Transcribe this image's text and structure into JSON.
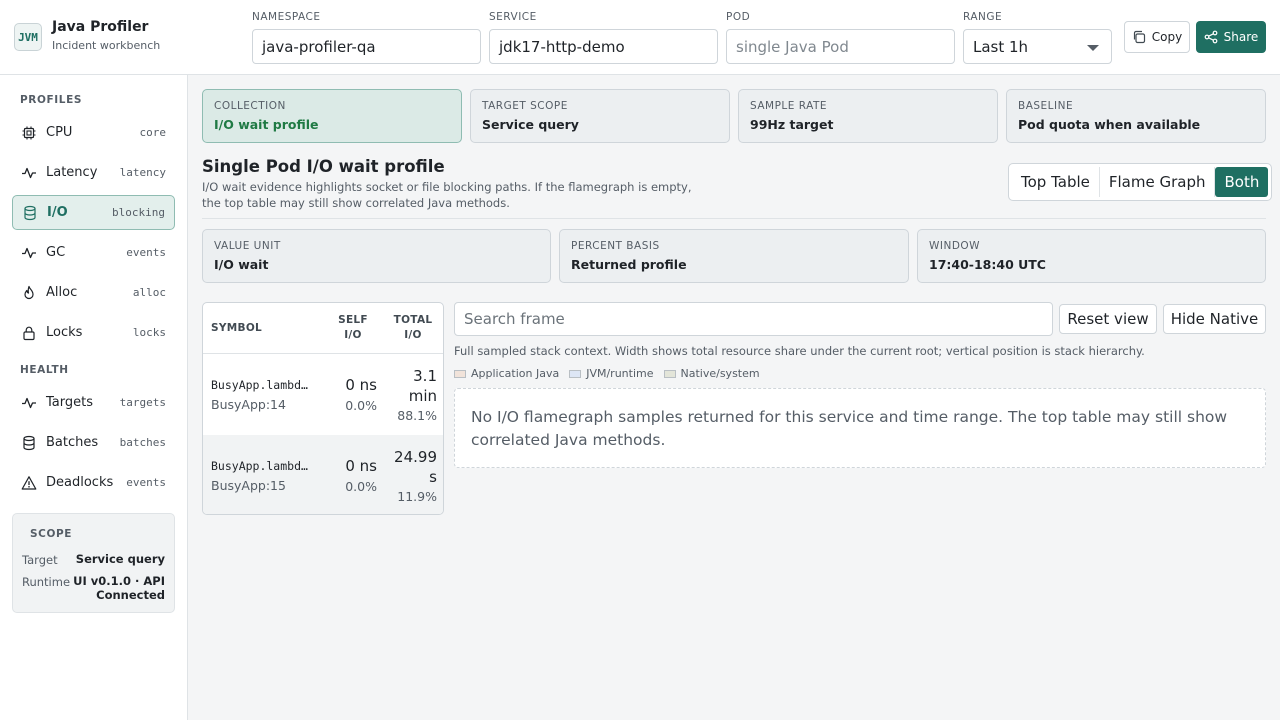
{
  "brand": {
    "logo": "JVM",
    "title": "Java Profiler",
    "subtitle": "Incident workbench"
  },
  "header": {
    "namespace": {
      "label": "NAMESPACE",
      "value": "java-profiler-qa"
    },
    "service": {
      "label": "SERVICE",
      "value": "jdk17-http-demo"
    },
    "pod": {
      "label": "POD",
      "placeholder": "single Java Pod"
    },
    "range": {
      "label": "RANGE",
      "value": "Last 1h"
    },
    "copy_label": "Copy",
    "share_label": "Share"
  },
  "sidebar": {
    "profiles_title": "PROFILES",
    "profiles": [
      {
        "label": "CPU",
        "tag": "core",
        "icon": "cpu-icon"
      },
      {
        "label": "Latency",
        "tag": "latency",
        "icon": "pulse-icon"
      },
      {
        "label": "I/O",
        "tag": "blocking",
        "icon": "database-icon",
        "active": true
      },
      {
        "label": "GC",
        "tag": "events",
        "icon": "pulse-icon"
      },
      {
        "label": "Alloc",
        "tag": "alloc",
        "icon": "flame-icon"
      },
      {
        "label": "Locks",
        "tag": "locks",
        "icon": "lock-icon"
      }
    ],
    "health_title": "HEALTH",
    "health": [
      {
        "label": "Targets",
        "tag": "targets",
        "icon": "pulse-icon"
      },
      {
        "label": "Batches",
        "tag": "batches",
        "icon": "database-icon"
      },
      {
        "label": "Deadlocks",
        "tag": "events",
        "icon": "warning-icon"
      }
    ],
    "scope": {
      "title": "SCOPE",
      "target_key": "Target",
      "target_value": "Service query",
      "runtime_key": "Runtime",
      "runtime_value_line1": "UI v0.1.0 · API",
      "runtime_value_line2": "Connected"
    }
  },
  "summary_cards": [
    {
      "key": "COLLECTION",
      "value": "I/O wait profile",
      "active": true
    },
    {
      "key": "TARGET SCOPE",
      "value": "Service query"
    },
    {
      "key": "SAMPLE RATE",
      "value": "99Hz target"
    },
    {
      "key": "BASELINE",
      "value": "Pod quota when available"
    }
  ],
  "page": {
    "title": "Single Pod I/O wait profile",
    "description": "I/O wait evidence highlights socket or file blocking paths. If the flamegraph is empty, the top table may still show correlated Java methods."
  },
  "view_toggle": {
    "options": [
      "Top Table",
      "Flame Graph",
      "Both"
    ],
    "selected": "Both"
  },
  "info_cards": [
    {
      "key": "VALUE UNIT",
      "value": "I/O wait"
    },
    {
      "key": "PERCENT BASIS",
      "value": "Returned profile"
    },
    {
      "key": "WINDOW",
      "value": "17:40-18:40 UTC"
    }
  ],
  "top_table": {
    "headers": {
      "symbol": "SYMBOL",
      "self_l1": "SELF",
      "self_l2": "I/O",
      "total_l1": "TOTAL",
      "total_l2": "I/O"
    },
    "rows": [
      {
        "symbol": "BusyApp.lambd…",
        "location": "BusyApp:14",
        "self": "0 ns",
        "self_pct": "0.0%",
        "total_l1": "3.1",
        "total_l2": "min",
        "total_pct": "88.1%"
      },
      {
        "symbol": "BusyApp.lambd…",
        "location": "BusyApp:15",
        "self": "0 ns",
        "self_pct": "0.0%",
        "total_l1": "24.99",
        "total_l2": "s",
        "total_pct": "11.9%"
      }
    ]
  },
  "flamegraph": {
    "search_placeholder": "Search frame",
    "reset_label": "Reset view",
    "hide_native_label": "Hide Native",
    "help": "Full sampled stack context. Width shows total resource share under the current root; vertical position is stack hierarchy.",
    "legend": [
      {
        "label": "Application Java",
        "color": "#f1e3da"
      },
      {
        "label": "JVM/runtime",
        "color": "#dde6f5"
      },
      {
        "label": "Native/system",
        "color": "#e3e5d9"
      }
    ],
    "empty_message": "No I/O flamegraph samples returned for this service and time range. The top table may still show correlated Java methods."
  },
  "colors": {
    "accent": "#1f6f62",
    "active_bg": "#e3efec",
    "success_text": "#1f7a44"
  }
}
